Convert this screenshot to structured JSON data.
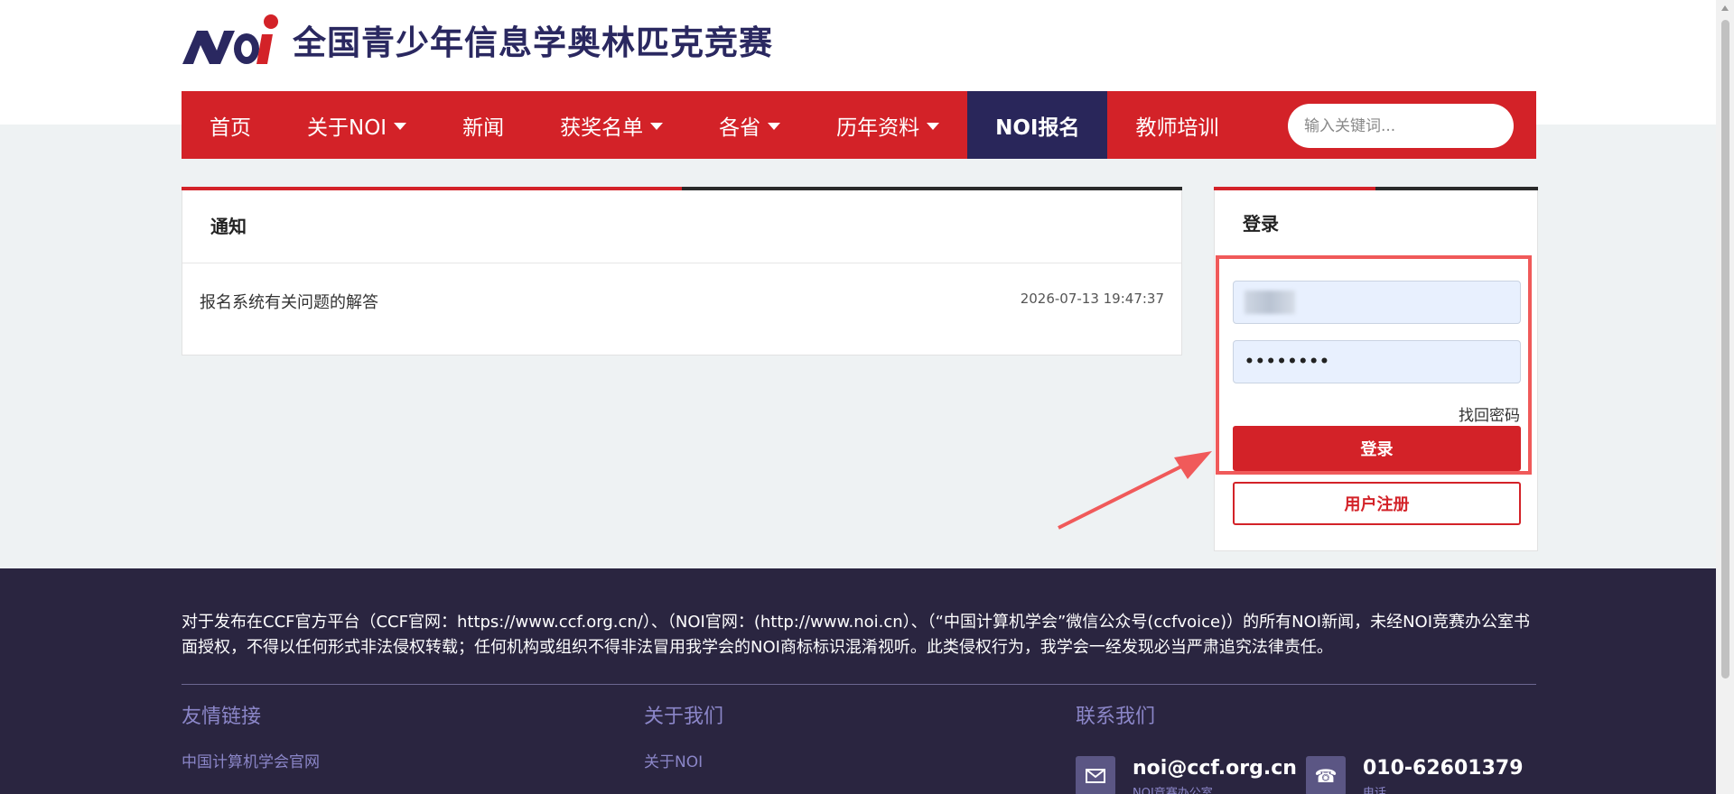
{
  "header": {
    "logo_text": "NOi",
    "site_title": "全国青少年信息学奥林匹克竞赛"
  },
  "nav": {
    "items": [
      {
        "label": "首页",
        "dropdown": false
      },
      {
        "label": "关于NOI",
        "dropdown": true
      },
      {
        "label": "新闻",
        "dropdown": false
      },
      {
        "label": "获奖名单",
        "dropdown": true
      },
      {
        "label": "各省",
        "dropdown": true
      },
      {
        "label": "历年资料",
        "dropdown": true
      },
      {
        "label": "NOI报名",
        "dropdown": false,
        "active": true
      },
      {
        "label": "教师培训",
        "dropdown": false
      }
    ],
    "search_placeholder": "输入关键词..."
  },
  "notice": {
    "title": "通知",
    "items": [
      {
        "title": "报名系统有关问题的解答",
        "time": "2026-07-13 19:47:37"
      }
    ]
  },
  "login": {
    "title": "登录",
    "password_mask": "••••••••",
    "forgot_label": "找回密码",
    "login_button": "登录",
    "register_button": "用户注册"
  },
  "footer": {
    "notice_text": "对于发布在CCF官方平台（CCF官网：https://www.ccf.org.cn/）、（NOI官网：(http://www.noi.cn）、（“中国计算机学会”微信公众号(ccfvoice)）的所有NOI新闻，未经NOI竞赛办公室书面授权，不得以任何形式非法侵权转载；任何机构或组织不得非法冒用我学会的NOI商标标识混淆视听。此类侵权行为，我学会一经发现必当严肃追究法律责任。",
    "links_title": "友情链接",
    "links": [
      "中国计算机学会官网"
    ],
    "about_title": "关于我们",
    "about_links": [
      "关于NOI"
    ],
    "contact_title": "联系我们",
    "email": "noi@ccf.org.cn",
    "email_sub": "NOI竞赛办公室",
    "phone": "010-62601379",
    "phone_sub": "电话"
  },
  "colors": {
    "brand_red": "#d32228",
    "brand_navy": "#29265a",
    "footer_bg": "#2a2540",
    "annotation": "#f05a5a"
  }
}
